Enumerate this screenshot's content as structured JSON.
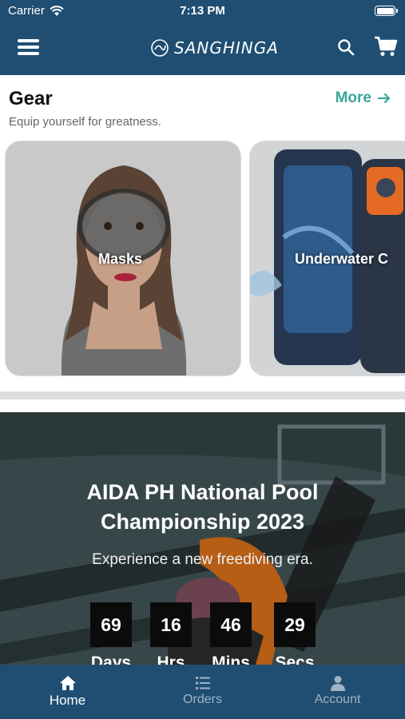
{
  "status": {
    "carrier": "Carrier",
    "time": "7:13 PM"
  },
  "header": {
    "brand": "SANGHINGA"
  },
  "gear": {
    "title": "Gear",
    "subtitle": "Equip yourself for greatness.",
    "more_label": "More",
    "cards": [
      {
        "label": "Masks"
      },
      {
        "label": "Underwater C"
      }
    ]
  },
  "banner": {
    "title_line1": "AIDA PH National Pool",
    "title_line2": "Championship 2023",
    "subtitle": "Experience a new freediving era.",
    "countdown": [
      {
        "value": "69",
        "label": "Days"
      },
      {
        "value": "16",
        "label": "Hrs"
      },
      {
        "value": "46",
        "label": "Mins"
      },
      {
        "value": "29",
        "label": "Secs"
      }
    ]
  },
  "tabs": [
    {
      "label": "Home",
      "icon": "home-icon",
      "active": true
    },
    {
      "label": "Orders",
      "icon": "list-icon",
      "active": false
    },
    {
      "label": "Account",
      "icon": "person-icon",
      "active": false
    }
  ],
  "colors": {
    "primary": "#1f4e72",
    "accent": "#3aa79b",
    "inactive": "#9fb3c6"
  }
}
